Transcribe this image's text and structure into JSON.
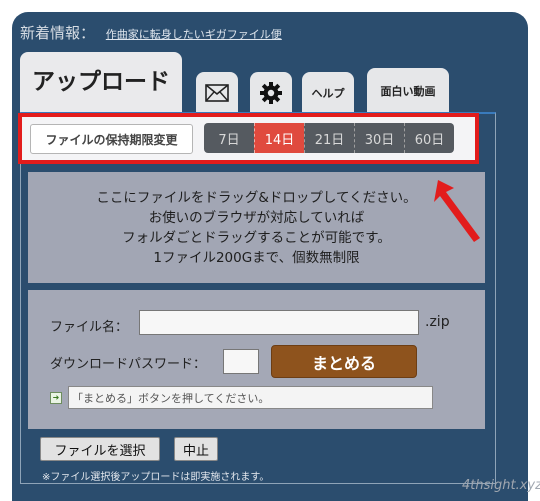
{
  "news": {
    "label": "新着情報：",
    "link_text": "作曲家に転身したいギガファイル便"
  },
  "tabs": {
    "upload": "アップロード",
    "mail_icon": "mail-icon",
    "settings_icon": "gear-icon",
    "help": "ヘルプ",
    "fun_videos": "面白い動画"
  },
  "retention": {
    "button_label": "ファイルの保持期限変更",
    "days": [
      "7日",
      "14日",
      "21日",
      "30日",
      "60日"
    ],
    "selected": "14日"
  },
  "drop_zone": {
    "line1": "ここにファイルをドラッグ&ドロップしてください。",
    "line2": "お使いのブラウザが対応していれば",
    "line3": "フォルダごとドラッグすることが可能です。",
    "line4": "1ファイル200Gまで、個数無制限"
  },
  "form": {
    "filename_label": "ファイル名：",
    "filename_value": "",
    "extension": ".zip",
    "password_label": "ダウンロードパスワード：",
    "password_value": "",
    "merge_button": "まとめる",
    "status_text": "「まとめる」ボタンを押してください。"
  },
  "actions": {
    "select_file": "ファイルを選択",
    "cancel": "中止",
    "note": "※ファイル選択後アップロードは即実施されます。"
  },
  "watermark": "4thsight.xyz",
  "colors": {
    "background": "#2b4d6e",
    "highlight_border": "#e21c1c",
    "active_day": "#e04a3e",
    "merge_button": "#8e531d"
  }
}
